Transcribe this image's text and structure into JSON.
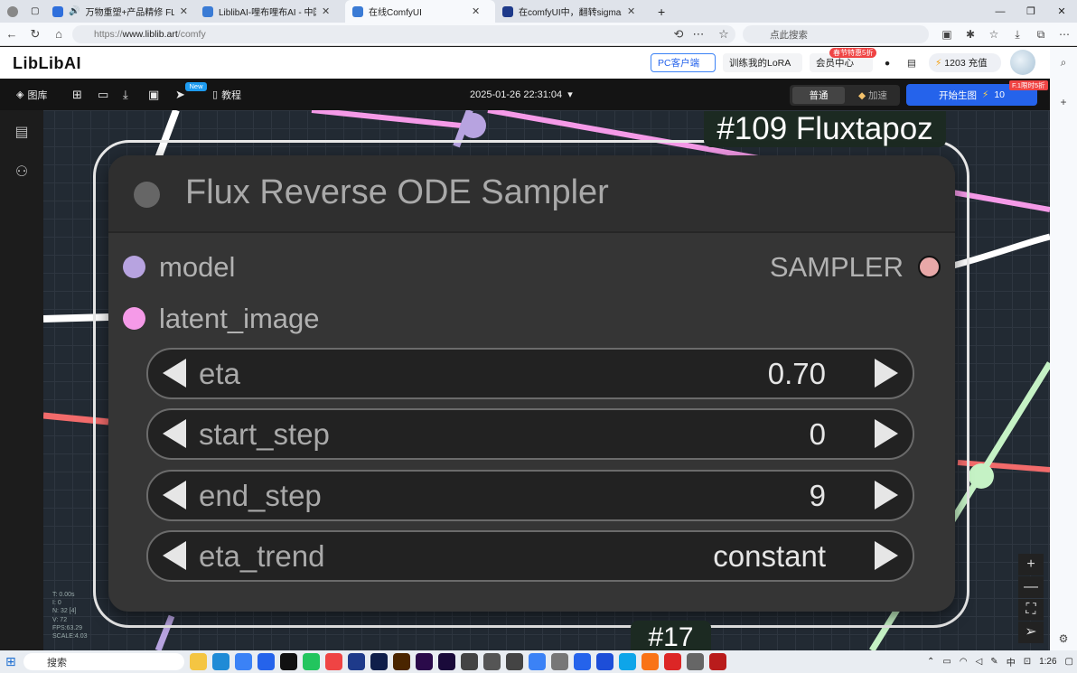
{
  "browser": {
    "tabs": [
      {
        "title": "万物重塑+产品精修 FLUX RF",
        "active": false
      },
      {
        "title": "LiblibAI-哩布哩布AI - 中国领先的",
        "active": false
      },
      {
        "title": "在线ComfyUI",
        "active": true
      },
      {
        "title": "在comfyUI中，翻转sigmas节点卡",
        "active": false
      }
    ],
    "url_scheme": "https://",
    "url_host": "www.liblib.art",
    "url_path": "/comfy",
    "search_placeholder": "点此搜索"
  },
  "liblib_header": {
    "logo_text": "LibLibAI",
    "pc_client": "PC客户端",
    "train_lora": "训练我的LoRA",
    "vip_badge": "春节特惠5折",
    "vip_center": "会员中心",
    "charge": "1203 充值"
  },
  "comfy_toolbar": {
    "library": "图库",
    "new_badge": "New",
    "tutorial": "教程",
    "datetime": "2025-01-26 22:31:04",
    "mode_normal": "普通",
    "mode_fast": "加速",
    "generate": "开始生图",
    "generate_cost": "10",
    "generate_badge": "F.1限时5折"
  },
  "node": {
    "group_title": "#109 Fluxtapoz",
    "title": "Flux Reverse ODE Sampler",
    "inputs": [
      {
        "name": "model",
        "color": "#b7a3e0"
      },
      {
        "name": "latent_image",
        "color": "#f59ae8"
      }
    ],
    "output": {
      "name": "SAMPLER",
      "color": "#e8a8a8"
    },
    "widgets": [
      {
        "name": "eta",
        "value": "0.70"
      },
      {
        "name": "start_step",
        "value": "0"
      },
      {
        "name": "end_step",
        "value": "9"
      },
      {
        "name": "eta_trend",
        "value": "constant"
      }
    ]
  },
  "second_node_tag": "#17",
  "canvas_stats": {
    "t": "T: 0.00s",
    "i": "I: 0",
    "n": "N: 32 [4]",
    "v": "V: 72",
    "fps": "FPS:63.29",
    "scale": "SCALE:4.03"
  },
  "taskbar": {
    "search": "搜索",
    "time": "1:26",
    "ime": "中"
  }
}
